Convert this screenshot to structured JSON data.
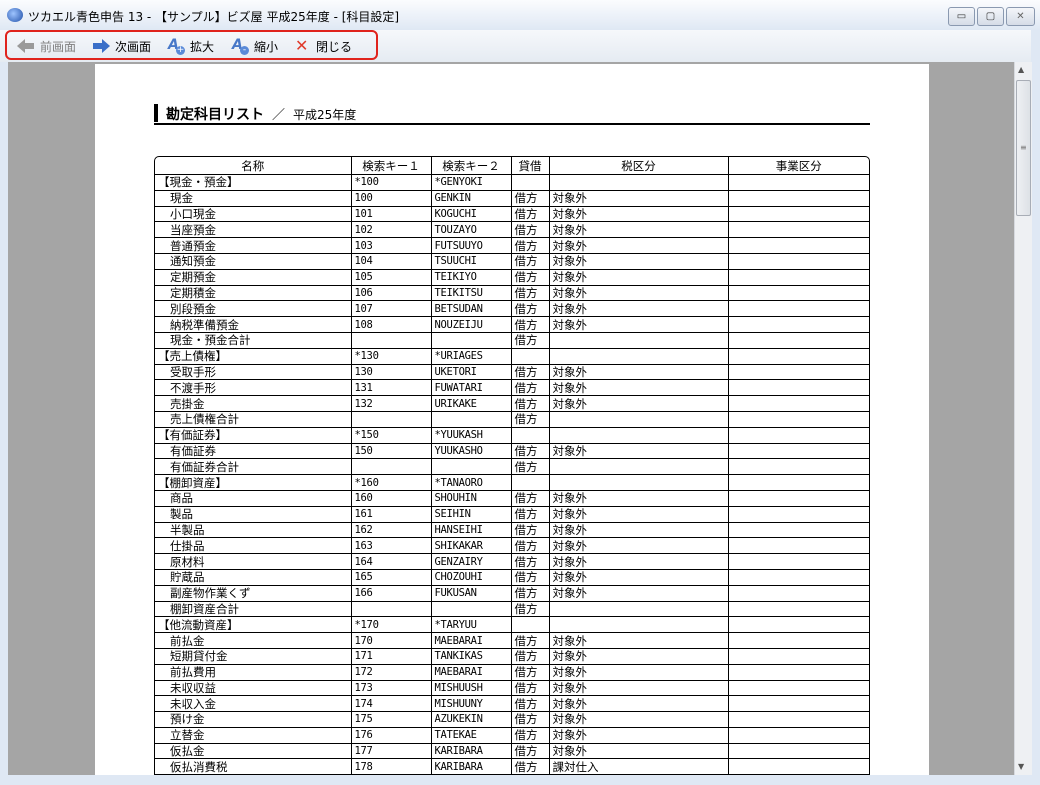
{
  "window": {
    "title": "ツカエル青色申告 13 - 【サンプル】ビズ屋 平成25年度 - [科目設定]",
    "min_label": "▭",
    "max_label": "▢",
    "close_label": "✕"
  },
  "toolbar": {
    "prev_label": "前画面",
    "next_label": "次画面",
    "zoom_in_label": "拡大",
    "zoom_out_label": "縮小",
    "close_label": "閉じる"
  },
  "document": {
    "title": "勘定科目リスト",
    "separator": "／",
    "year": "平成25年度",
    "columns": [
      "名称",
      "検索キー１",
      "検索キー２",
      "貸借",
      "税区分",
      "事業区分"
    ],
    "rows": [
      {
        "name": "【現金・預金】",
        "group": true,
        "key1": "*100",
        "key2": "*GENYOKI",
        "dc": "",
        "tax": "",
        "biz": ""
      },
      {
        "name": "現金",
        "group": false,
        "key1": "100",
        "key2": "GENKIN",
        "dc": "借方",
        "tax": "対象外",
        "biz": ""
      },
      {
        "name": "小口現金",
        "group": false,
        "key1": "101",
        "key2": "KOGUCHI",
        "dc": "借方",
        "tax": "対象外",
        "biz": ""
      },
      {
        "name": "当座預金",
        "group": false,
        "key1": "102",
        "key2": "TOUZAYO",
        "dc": "借方",
        "tax": "対象外",
        "biz": ""
      },
      {
        "name": "普通預金",
        "group": false,
        "key1": "103",
        "key2": "FUTSUUYO",
        "dc": "借方",
        "tax": "対象外",
        "biz": ""
      },
      {
        "name": "通知預金",
        "group": false,
        "key1": "104",
        "key2": "TSUUCHI",
        "dc": "借方",
        "tax": "対象外",
        "biz": ""
      },
      {
        "name": "定期預金",
        "group": false,
        "key1": "105",
        "key2": "TEIKIYO",
        "dc": "借方",
        "tax": "対象外",
        "biz": ""
      },
      {
        "name": "定期積金",
        "group": false,
        "key1": "106",
        "key2": "TEIKITSU",
        "dc": "借方",
        "tax": "対象外",
        "biz": ""
      },
      {
        "name": "別段預金",
        "group": false,
        "key1": "107",
        "key2": "BETSUDAN",
        "dc": "借方",
        "tax": "対象外",
        "biz": ""
      },
      {
        "name": "納税準備預金",
        "group": false,
        "key1": "108",
        "key2": "NOUZEIJU",
        "dc": "借方",
        "tax": "対象外",
        "biz": ""
      },
      {
        "name": "現金・預金合計",
        "group": false,
        "key1": "",
        "key2": "",
        "dc": "借方",
        "tax": "",
        "biz": ""
      },
      {
        "name": "【売上債権】",
        "group": true,
        "key1": "*130",
        "key2": "*URIAGES",
        "dc": "",
        "tax": "",
        "biz": ""
      },
      {
        "name": "受取手形",
        "group": false,
        "key1": "130",
        "key2": "UKETORI",
        "dc": "借方",
        "tax": "対象外",
        "biz": ""
      },
      {
        "name": "不渡手形",
        "group": false,
        "key1": "131",
        "key2": "FUWATARI",
        "dc": "借方",
        "tax": "対象外",
        "biz": ""
      },
      {
        "name": "売掛金",
        "group": false,
        "key1": "132",
        "key2": "URIKAKE",
        "dc": "借方",
        "tax": "対象外",
        "biz": ""
      },
      {
        "name": "売上債権合計",
        "group": false,
        "key1": "",
        "key2": "",
        "dc": "借方",
        "tax": "",
        "biz": ""
      },
      {
        "name": "【有価証券】",
        "group": true,
        "key1": "*150",
        "key2": "*YUUKASH",
        "dc": "",
        "tax": "",
        "biz": ""
      },
      {
        "name": "有価証券",
        "group": false,
        "key1": "150",
        "key2": "YUUKASHO",
        "dc": "借方",
        "tax": "対象外",
        "biz": ""
      },
      {
        "name": "有価証券合計",
        "group": false,
        "key1": "",
        "key2": "",
        "dc": "借方",
        "tax": "",
        "biz": ""
      },
      {
        "name": "【棚卸資産】",
        "group": true,
        "key1": "*160",
        "key2": "*TANAORO",
        "dc": "",
        "tax": "",
        "biz": ""
      },
      {
        "name": "商品",
        "group": false,
        "key1": "160",
        "key2": "SHOUHIN",
        "dc": "借方",
        "tax": "対象外",
        "biz": ""
      },
      {
        "name": "製品",
        "group": false,
        "key1": "161",
        "key2": "SEIHIN",
        "dc": "借方",
        "tax": "対象外",
        "biz": ""
      },
      {
        "name": "半製品",
        "group": false,
        "key1": "162",
        "key2": "HANSEIHI",
        "dc": "借方",
        "tax": "対象外",
        "biz": ""
      },
      {
        "name": "仕掛品",
        "group": false,
        "key1": "163",
        "key2": "SHIKAKAR",
        "dc": "借方",
        "tax": "対象外",
        "biz": ""
      },
      {
        "name": "原材料",
        "group": false,
        "key1": "164",
        "key2": "GENZAIRY",
        "dc": "借方",
        "tax": "対象外",
        "biz": ""
      },
      {
        "name": "貯蔵品",
        "group": false,
        "key1": "165",
        "key2": "CHOZOUHI",
        "dc": "借方",
        "tax": "対象外",
        "biz": ""
      },
      {
        "name": "副産物作業くず",
        "group": false,
        "key1": "166",
        "key2": "FUKUSAN",
        "dc": "借方",
        "tax": "対象外",
        "biz": ""
      },
      {
        "name": "棚卸資産合計",
        "group": false,
        "key1": "",
        "key2": "",
        "dc": "借方",
        "tax": "",
        "biz": ""
      },
      {
        "name": "【他流動資産】",
        "group": true,
        "key1": "*170",
        "key2": "*TARYUU",
        "dc": "",
        "tax": "",
        "biz": ""
      },
      {
        "name": "前払金",
        "group": false,
        "key1": "170",
        "key2": "MAEBARAI",
        "dc": "借方",
        "tax": "対象外",
        "biz": ""
      },
      {
        "name": "短期貸付金",
        "group": false,
        "key1": "171",
        "key2": "TANKIKAS",
        "dc": "借方",
        "tax": "対象外",
        "biz": ""
      },
      {
        "name": "前払費用",
        "group": false,
        "key1": "172",
        "key2": "MAEBARAI",
        "dc": "借方",
        "tax": "対象外",
        "biz": ""
      },
      {
        "name": "未収収益",
        "group": false,
        "key1": "173",
        "key2": "MISHUUSH",
        "dc": "借方",
        "tax": "対象外",
        "biz": ""
      },
      {
        "name": "未収入金",
        "group": false,
        "key1": "174",
        "key2": "MISHUUNY",
        "dc": "借方",
        "tax": "対象外",
        "biz": ""
      },
      {
        "name": "預け金",
        "group": false,
        "key1": "175",
        "key2": "AZUKEKIN",
        "dc": "借方",
        "tax": "対象外",
        "biz": ""
      },
      {
        "name": "立替金",
        "group": false,
        "key1": "176",
        "key2": "TATEKAE",
        "dc": "借方",
        "tax": "対象外",
        "biz": ""
      },
      {
        "name": "仮払金",
        "group": false,
        "key1": "177",
        "key2": "KARIBARA",
        "dc": "借方",
        "tax": "対象外",
        "biz": ""
      },
      {
        "name": "仮払消費税",
        "group": false,
        "key1": "178",
        "key2": "KARIBARA",
        "dc": "借方",
        "tax": "課対仕入",
        "biz": ""
      }
    ]
  }
}
